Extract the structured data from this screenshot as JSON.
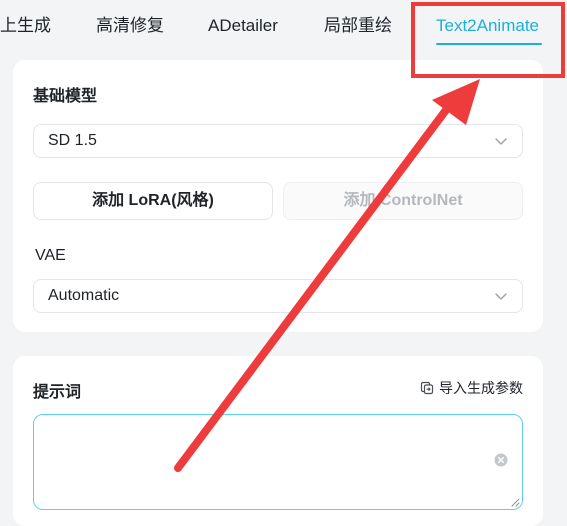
{
  "tabs": [
    {
      "label": "上生成"
    },
    {
      "label": "高清修复"
    },
    {
      "label": "ADetailer"
    },
    {
      "label": "局部重绘"
    },
    {
      "label": "Text2Animate",
      "active": true
    }
  ],
  "model_section": {
    "title": "基础模型",
    "model_select": {
      "value": "SD 1.5"
    },
    "lora_button": {
      "label": "添加 LoRA(风格)"
    },
    "controlnet_button": {
      "label": "添加 ControlNet",
      "disabled": true
    },
    "vae_label": "VAE",
    "vae_select": {
      "value": "Automatic"
    }
  },
  "prompt_section": {
    "title": "提示词",
    "import_label": "导入生成参数",
    "textarea_value": ""
  },
  "annotation": {
    "color": "#ee3b3b",
    "target": "Text2Animate"
  },
  "colors": {
    "accent": "#1ab0d8",
    "annotation": "#ee3b3b"
  }
}
